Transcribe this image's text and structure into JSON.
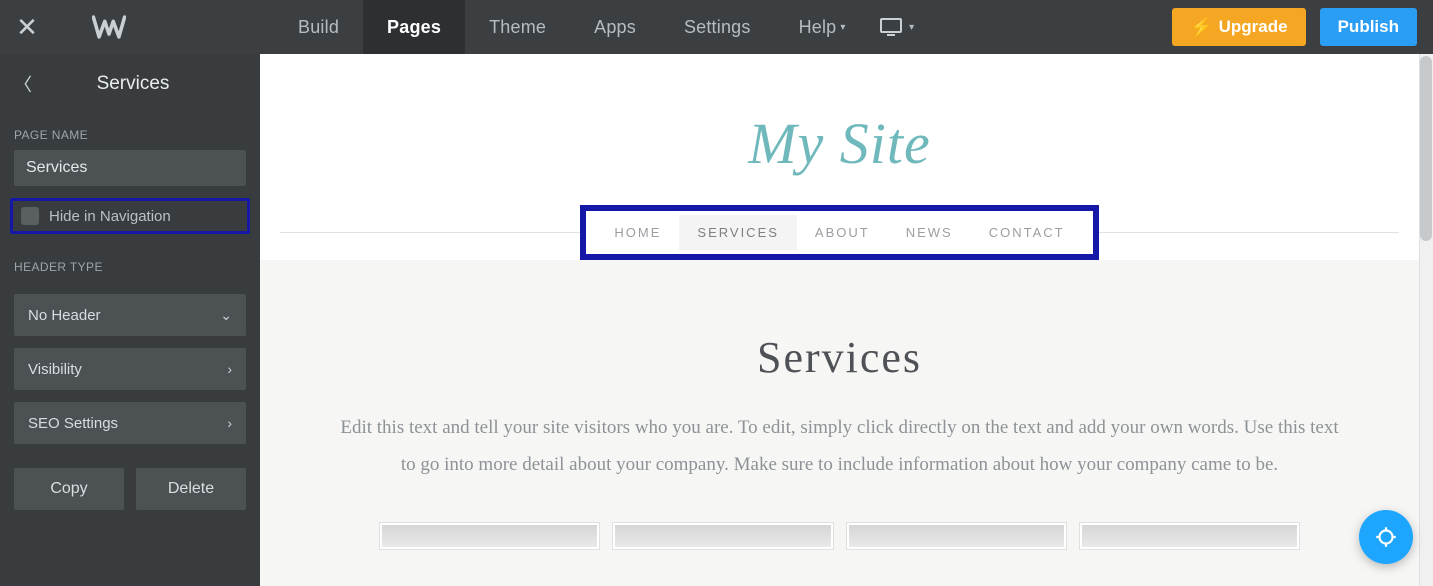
{
  "topbar": {
    "tabs": [
      "Build",
      "Pages",
      "Theme",
      "Apps",
      "Settings",
      "Help"
    ],
    "activeTab": "Pages",
    "upgrade": "Upgrade",
    "publish": "Publish"
  },
  "sidebar": {
    "title": "Services",
    "pageNameLabel": "PAGE NAME",
    "pageNameValue": "Services",
    "hideLabel": "Hide in Navigation",
    "headerTypeLabel": "HEADER TYPE",
    "headerSelect": "No Header",
    "rows": [
      "Visibility",
      "SEO Settings"
    ],
    "copy": "Copy",
    "delete": "Delete"
  },
  "preview": {
    "siteTitle": "My Site",
    "nav": [
      "HOME",
      "SERVICES",
      "ABOUT",
      "NEWS",
      "CONTACT"
    ],
    "activeNav": "SERVICES",
    "heading": "Services",
    "desc": "Edit this text and tell your site visitors who you are. To edit, simply click directly on the text and add your own words. Use this text to go into more detail about your company. Make sure to include information about how your company came to be."
  }
}
